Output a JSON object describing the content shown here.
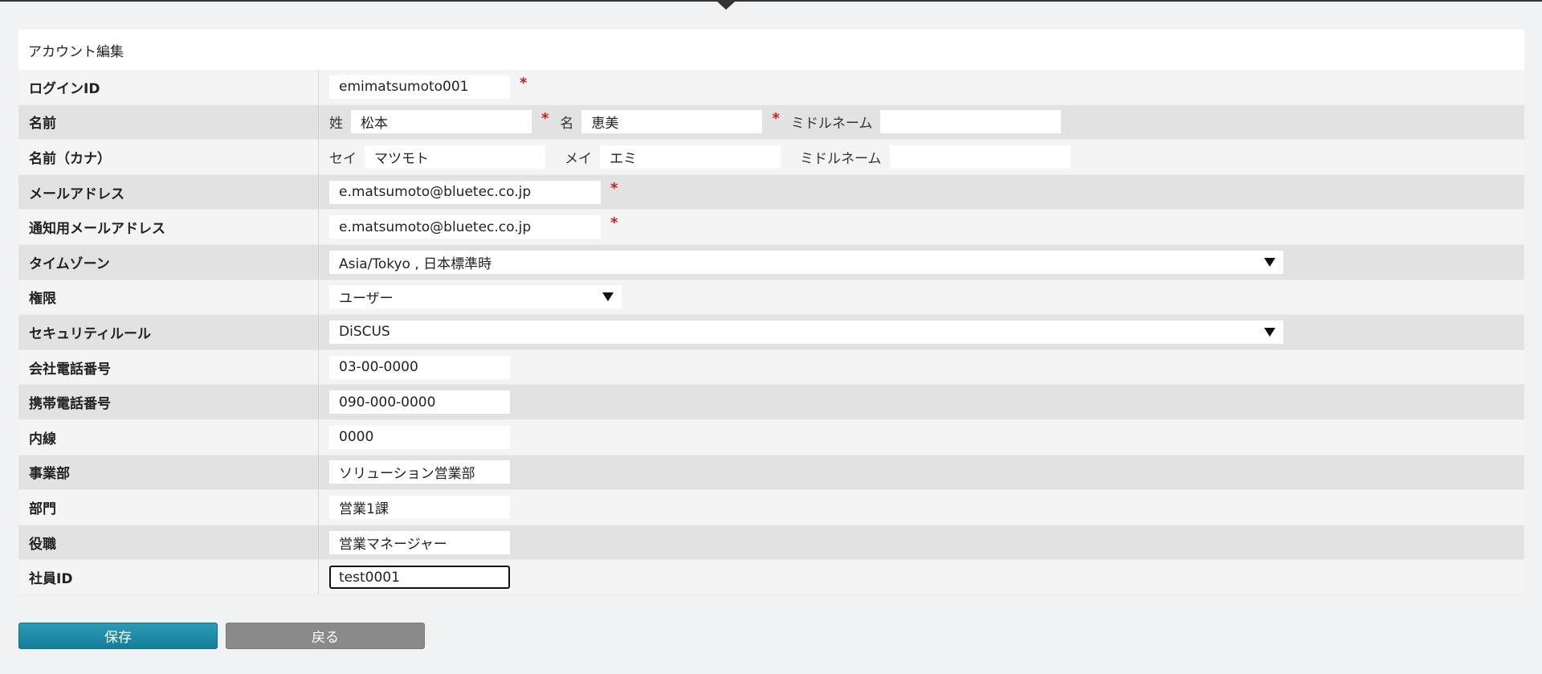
{
  "panel": {
    "title": "アカウント編集"
  },
  "required_mark": "*",
  "fields": {
    "login_id": {
      "label": "ログインID",
      "value": "emimatsumoto001"
    },
    "name": {
      "label": "名前",
      "last_label": "姓",
      "last_value": "松本",
      "first_label": "名",
      "first_value": "恵美",
      "middle_label": "ミドルネーム",
      "middle_value": ""
    },
    "name_kana": {
      "label": "名前（カナ）",
      "last_label": "セイ",
      "last_value": "マツモト",
      "first_label": "メイ",
      "first_value": "エミ",
      "middle_label": "ミドルネーム",
      "middle_value": ""
    },
    "email": {
      "label": "メールアドレス",
      "value": "e.matsumoto@bluetec.co.jp"
    },
    "notify_email": {
      "label": "通知用メールアドレス",
      "value": "e.matsumoto@bluetec.co.jp"
    },
    "timezone": {
      "label": "タイムゾーン",
      "value": "Asia/Tokyo , 日本標準時"
    },
    "role": {
      "label": "権限",
      "value": "ユーザー"
    },
    "security_rule": {
      "label": "セキュリティルール",
      "value": "DiSCUS"
    },
    "office_phone": {
      "label": "会社電話番号",
      "value": "03-00-0000"
    },
    "mobile_phone": {
      "label": "携帯電話番号",
      "value": "090-000-0000"
    },
    "extension": {
      "label": "内線",
      "value": "0000"
    },
    "division": {
      "label": "事業部",
      "value": "ソリューション営業部"
    },
    "department": {
      "label": "部門",
      "value": "営業1課"
    },
    "position": {
      "label": "役職",
      "value": "営業マネージャー"
    },
    "employee_id": {
      "label": "社員ID",
      "value": "test0001"
    }
  },
  "buttons": {
    "save": "保存",
    "back": "戻る"
  },
  "colors": {
    "save_button": "#1f8ca8",
    "back_button": "#8a8a8a",
    "required": "#d61a1a"
  }
}
